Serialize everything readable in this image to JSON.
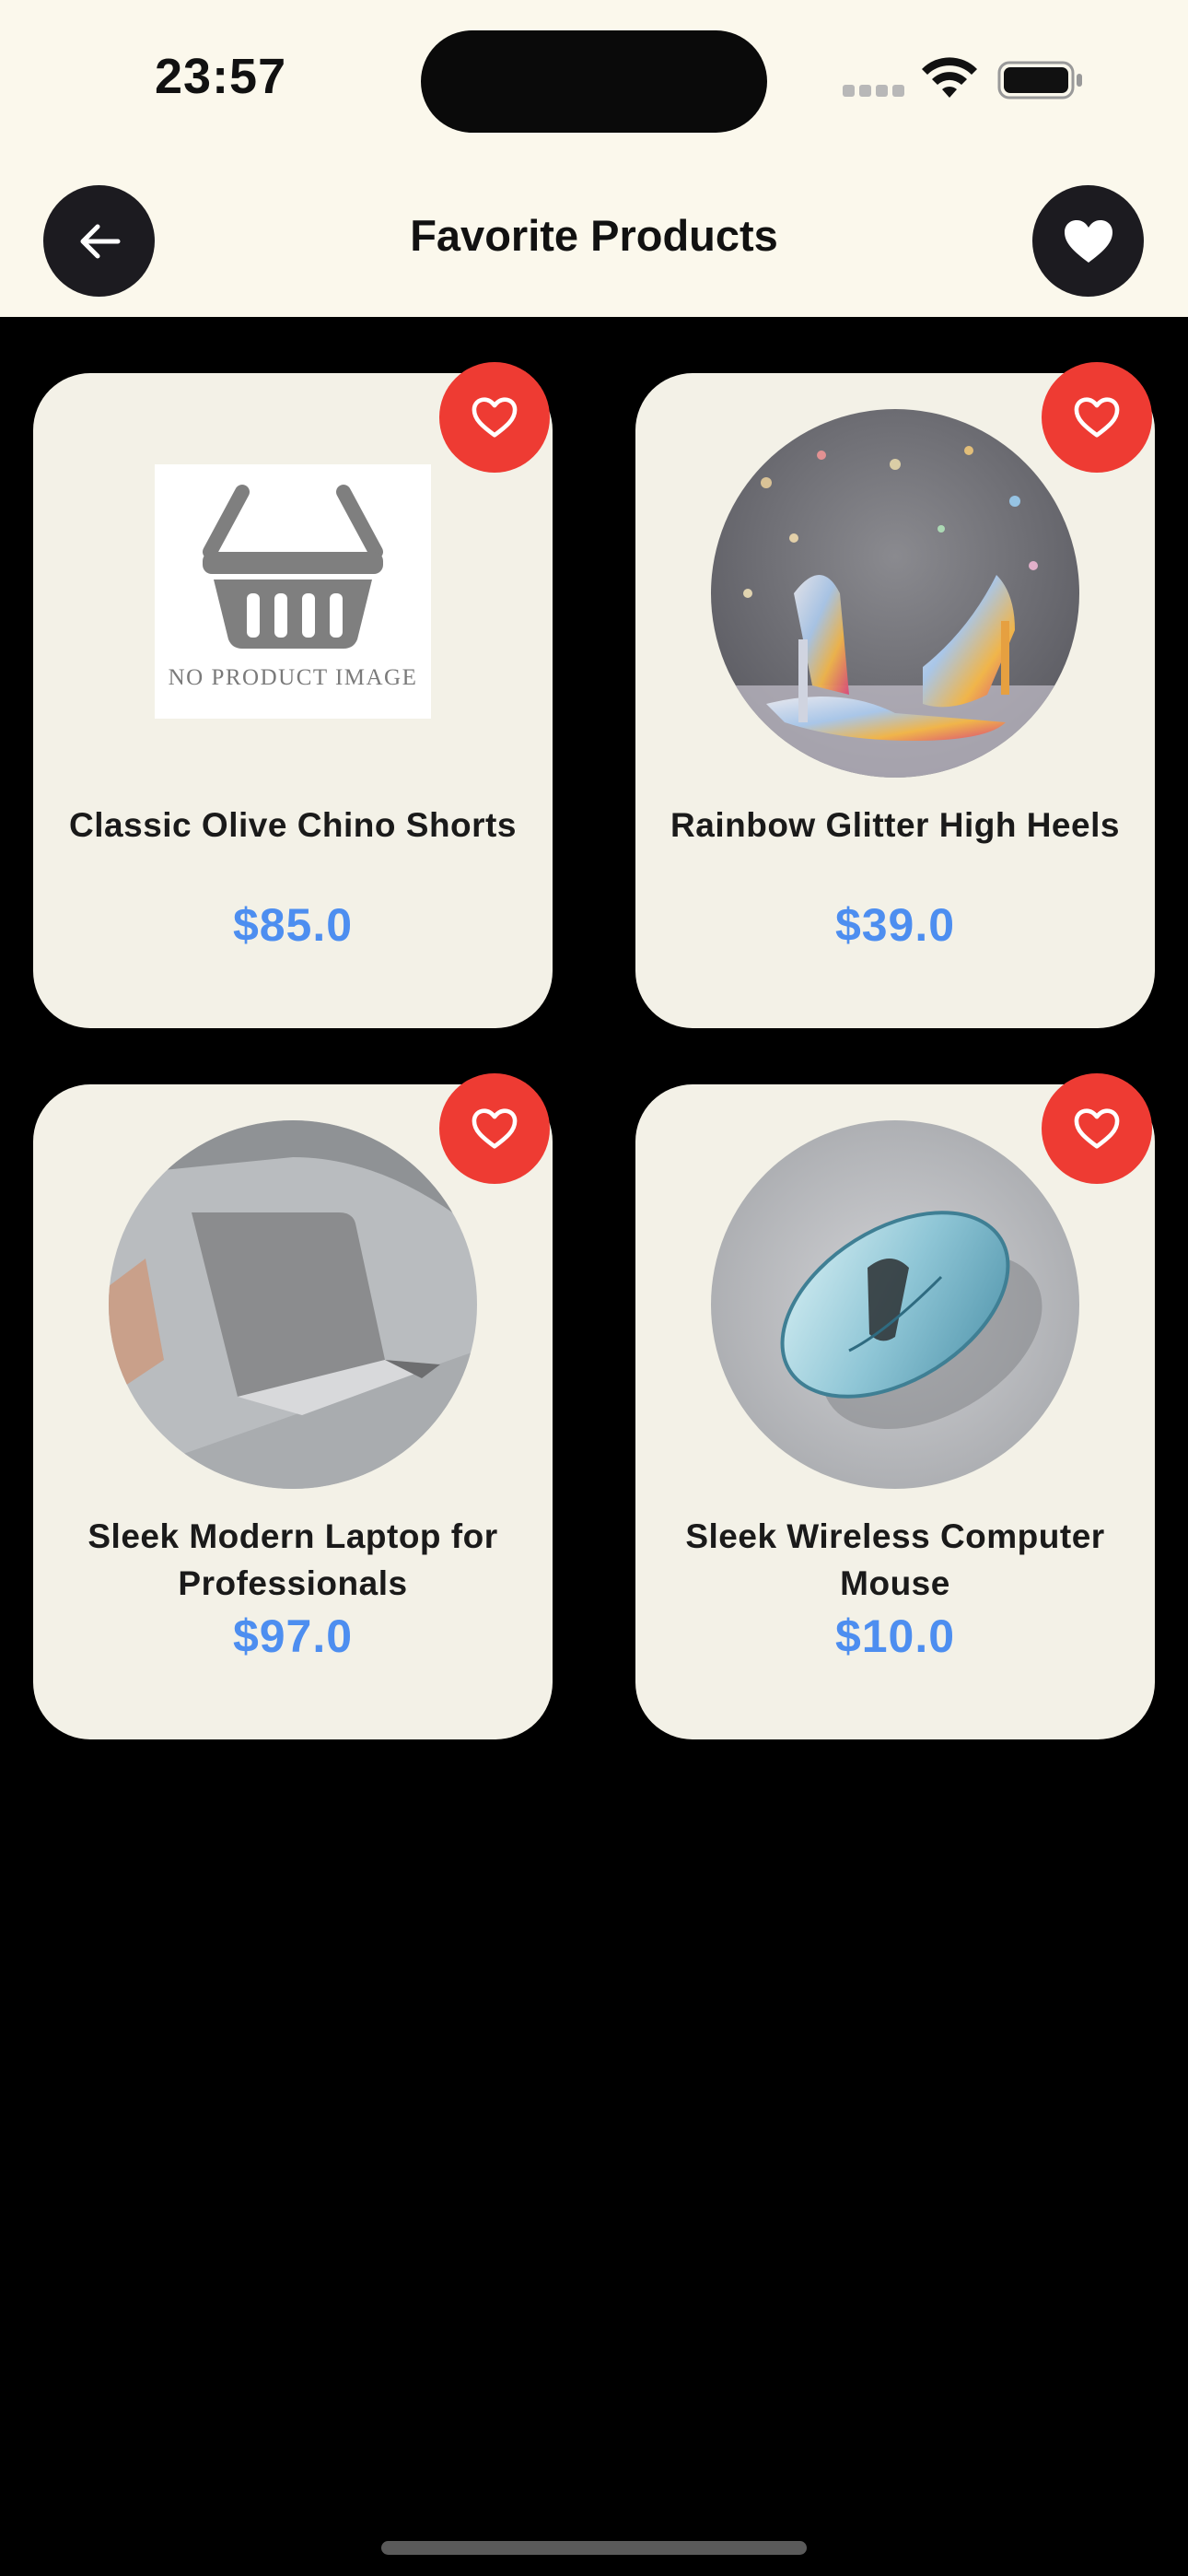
{
  "status_bar": {
    "time": "23:57",
    "icons": [
      "cellular-signal-icon",
      "wifi-icon",
      "battery-icon"
    ]
  },
  "header": {
    "title": "Favorite Products",
    "back_icon": "arrow-left-icon",
    "favorites_icon": "heart-filled-icon"
  },
  "products": [
    {
      "name": "Classic Olive Chino Shorts",
      "price": "$85.0",
      "image": "no-product-image",
      "placeholder_text": "NO PRODUCT IMAGE",
      "favorite": true
    },
    {
      "name": "Rainbow Glitter High Heels",
      "price": "$39.0",
      "image": "glitter-high-heels-photo",
      "favorite": true
    },
    {
      "name": "Sleek Modern Laptop for Professionals",
      "price": "$97.0",
      "image": "laptop-photo",
      "favorite": true
    },
    {
      "name": "Sleek Wireless Computer Mouse",
      "price": "$10.0",
      "image": "wireless-mouse-photo",
      "favorite": true
    }
  ],
  "colors": {
    "header_bg": "#FBF8EC",
    "page_bg": "#000000",
    "card_bg": "#F3F1E7",
    "price": "#4D8EF0",
    "favorite_badge": "#EE3B33",
    "dark_button": "#1C1B20"
  }
}
